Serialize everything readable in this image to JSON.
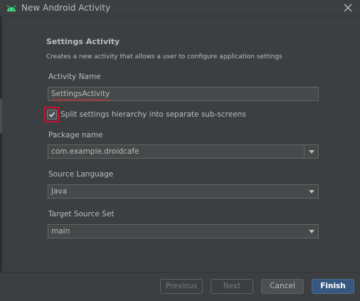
{
  "window": {
    "title": "New Android Activity"
  },
  "header": {
    "title": "Settings Activity",
    "description": "Creates a new activity that allows a user to configure application settings"
  },
  "fields": {
    "activity_name_label": "Activity Name",
    "activity_name_value": "SettingsActivity",
    "split_label": "Split settings hierarchy into separate sub-screens",
    "split_checked": true,
    "package_label": "Package name",
    "package_value": "com.example.droidcafe",
    "source_language_label": "Source Language",
    "source_language_value": "Java",
    "target_source_set_label": "Target Source Set",
    "target_source_set_value": "main"
  },
  "buttons": {
    "previous": "Previous",
    "next": "Next",
    "cancel": "Cancel",
    "finish": "Finish"
  },
  "colors": {
    "background": "#3c3f41",
    "field_bg": "#45494a",
    "primary_button": "#365880",
    "highlight": "#c8102e",
    "android_green": "#3ddc84"
  },
  "icons": {
    "app": "android-icon",
    "close": "close-icon",
    "check": "check-icon",
    "dropdown": "chevron-down-icon"
  }
}
